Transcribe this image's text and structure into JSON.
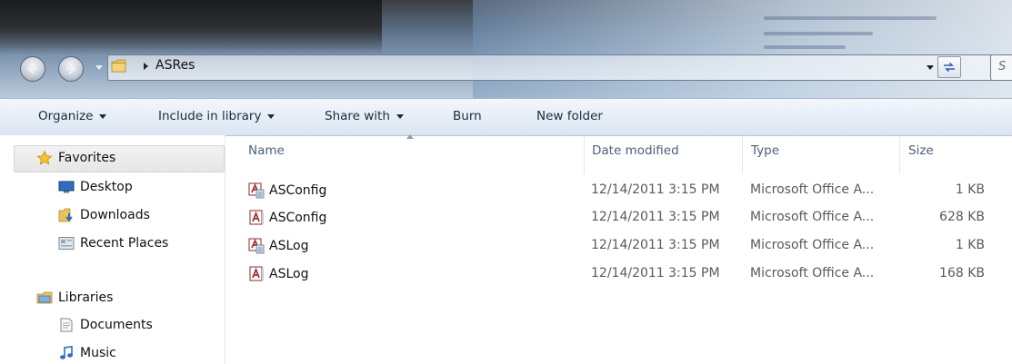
{
  "window": {
    "address": {
      "breadcrumb": [
        "ASRes"
      ],
      "search_placeholder": "S"
    }
  },
  "toolbar": {
    "items": [
      {
        "label": "Organize",
        "has_dropdown": true
      },
      {
        "label": "Include in library",
        "has_dropdown": true
      },
      {
        "label": "Share with",
        "has_dropdown": true
      },
      {
        "label": "Burn",
        "has_dropdown": false
      },
      {
        "label": "New folder",
        "has_dropdown": false
      }
    ]
  },
  "navigation": {
    "favorites": {
      "label": "Favorites",
      "icon": "star-icon",
      "items": [
        {
          "label": "Desktop",
          "icon": "desktop-icon"
        },
        {
          "label": "Downloads",
          "icon": "downloads-folder-icon"
        },
        {
          "label": "Recent Places",
          "icon": "recent-places-icon"
        }
      ]
    },
    "libraries": {
      "label": "Libraries",
      "icon": "libraries-icon",
      "items": [
        {
          "label": "Documents",
          "icon": "documents-icon"
        },
        {
          "label": "Music",
          "icon": "music-icon"
        }
      ]
    }
  },
  "file_list": {
    "columns": [
      "Name",
      "Date modified",
      "Type",
      "Size"
    ],
    "sorted_by": "Name",
    "rows": [
      {
        "name": "ASConfig",
        "date": "12/14/2011 3:15 PM",
        "type": "Microsoft Office A...",
        "size": "1 KB",
        "icon": "access-shortcut-icon"
      },
      {
        "name": "ASConfig",
        "date": "12/14/2011 3:15 PM",
        "type": "Microsoft Office A...",
        "size": "628 KB",
        "icon": "access-database-icon"
      },
      {
        "name": "ASLog",
        "date": "12/14/2011 3:15 PM",
        "type": "Microsoft Office A...",
        "size": "1 KB",
        "icon": "access-shortcut-icon"
      },
      {
        "name": "ASLog",
        "date": "12/14/2011 3:15 PM",
        "type": "Microsoft Office A...",
        "size": "168 KB",
        "icon": "access-database-icon"
      }
    ]
  },
  "colors": {
    "toolbar_text": "#1e2b3c",
    "column_header_text": "#4c607a",
    "secondary_text": "#5a5a5a",
    "access_icon": "#a4373a"
  }
}
